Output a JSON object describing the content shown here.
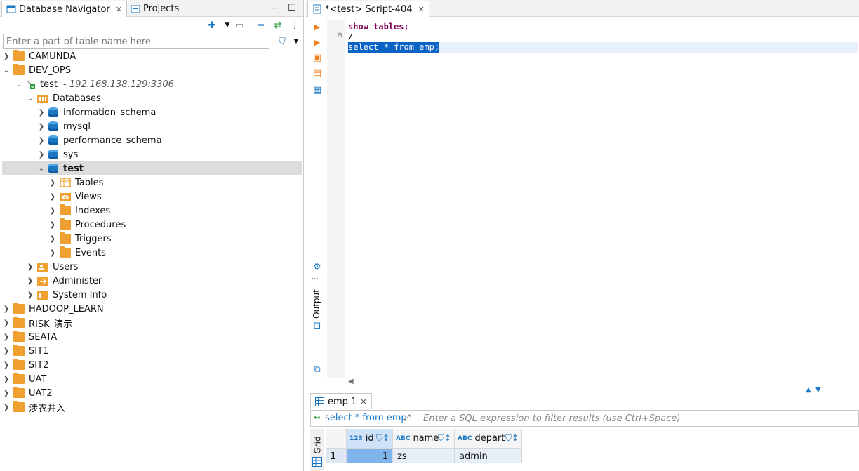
{
  "left_panel": {
    "tabs": [
      {
        "label": "Database Navigator",
        "icon": "database-navigator-icon",
        "active": true
      },
      {
        "label": "Projects",
        "icon": "projects-icon",
        "active": false
      }
    ],
    "search": {
      "placeholder": "Enter a part of table name here",
      "value": ""
    },
    "tree": {
      "camunda": "CAMUNDA",
      "dev_ops": "DEV_OPS",
      "test_conn": "test",
      "test_conn_host": "- 192.168.138.129:3306",
      "databases": "Databases",
      "information_schema": "information_schema",
      "mysql": "mysql",
      "performance_schema": "performance_schema",
      "sys": "sys",
      "test_db": "test",
      "tables": "Tables",
      "views": "Views",
      "indexes": "Indexes",
      "procedures": "Procedures",
      "triggers": "Triggers",
      "events": "Events",
      "users": "Users",
      "administer": "Administer",
      "system_info": "System Info",
      "hadoop_learn": "HADOOP_LEARN",
      "risk": "RISK_演示",
      "seata": "SEATA",
      "sit1": "SIT1",
      "sit2": "SIT2",
      "uat": "UAT",
      "uat2": "UAT2",
      "shenong": "涉农并入"
    }
  },
  "editor": {
    "tab": {
      "label": "*<test> Script-404"
    },
    "lines": [
      "show tables;",
      "/",
      "select * from emp;"
    ],
    "output_label": "Output"
  },
  "results": {
    "tab_label": "emp 1",
    "query_label": "select * from emp",
    "filter_placeholder": "Enter a SQL expression to filter results (use Ctrl+Space)",
    "grid_label": "Grid",
    "columns": [
      {
        "type": "123",
        "name": "id"
      },
      {
        "type": "ABC",
        "name": "name"
      },
      {
        "type": "ABC",
        "name": "depart"
      }
    ],
    "rows": [
      {
        "num": "1",
        "cells": [
          "1",
          "zs",
          "admin"
        ]
      }
    ]
  },
  "colors": {
    "accent": "#1c77c3",
    "folder": "#f0a030",
    "selection": "#0c63c6"
  }
}
